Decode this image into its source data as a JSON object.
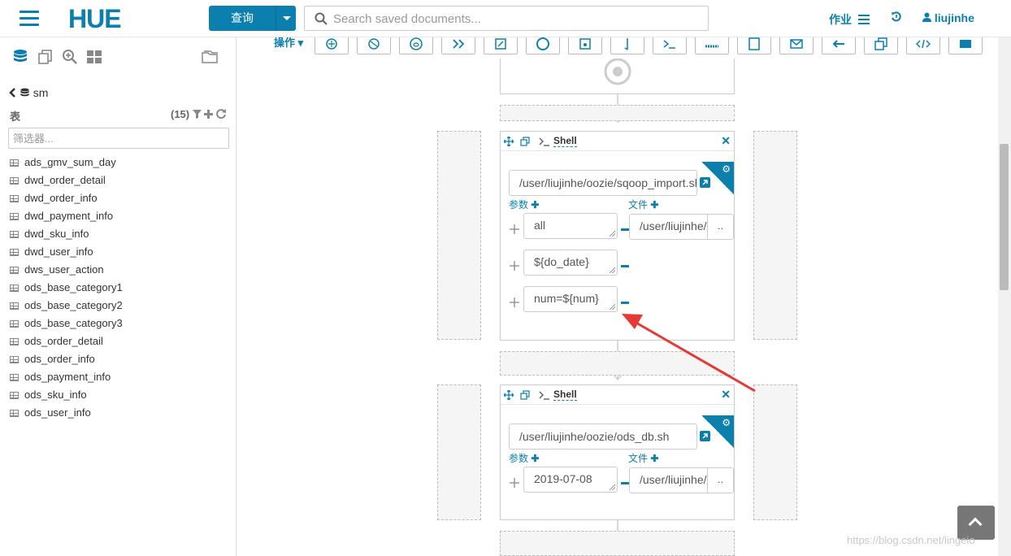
{
  "header": {
    "logo": "HUE",
    "query_button": "查询",
    "search_placeholder": "Search saved documents...",
    "jobs_label": "作业",
    "user_label": "liujinhe"
  },
  "sidebar": {
    "database": "sm",
    "tables_label": "表",
    "table_count": "(15)",
    "filter_placeholder": "筛选器...",
    "tables": [
      "ads_gmv_sum_day",
      "dwd_order_detail",
      "dwd_order_info",
      "dwd_payment_info",
      "dwd_sku_info",
      "dwd_user_info",
      "dws_user_action",
      "ods_base_category1",
      "ods_base_category2",
      "ods_base_category3",
      "ods_order_detail",
      "ods_order_info",
      "ods_payment_info",
      "ods_sku_info",
      "ods_user_info"
    ]
  },
  "workflow": {
    "actions_label": "操作",
    "node1": {
      "type": "Shell",
      "script_path": "/user/liujinhe/oozie/sqoop_import.sh",
      "params_label": "参数",
      "files_label": "文件",
      "args": [
        "all",
        "${do_date}",
        "num=${num}"
      ],
      "file": "/user/liujinhe/oozie/sqoop_import.sh",
      "file_browse": ".."
    },
    "node2": {
      "type": "Shell",
      "script_path": "/user/liujinhe/oozie/ods_db.sh",
      "params_label": "参数",
      "files_label": "文件",
      "args": [
        "2019-07-08"
      ],
      "file": "/user/liujinhe/oozie/ods_db.sh",
      "file_browse": ".."
    }
  },
  "watermark": "https://blog.csdn.net/lingeio",
  "colors": {
    "accent": "#0B7FAD",
    "annotation": "#E53935"
  }
}
